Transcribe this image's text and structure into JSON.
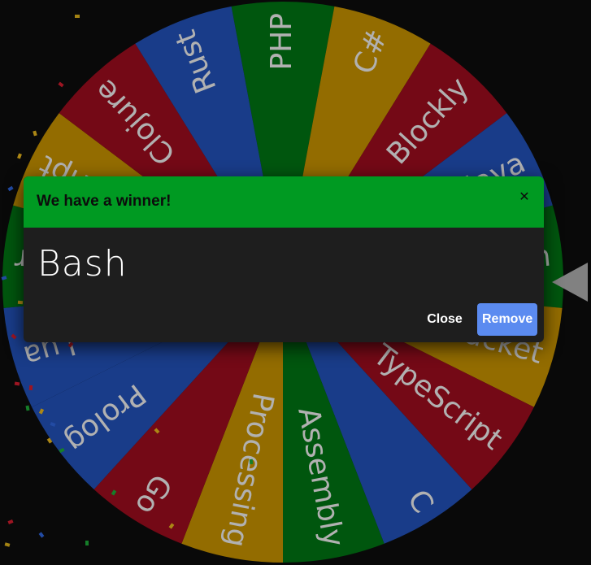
{
  "wheel": {
    "segments": [
      {
        "label": "PHP",
        "color": "#006a12"
      },
      {
        "label": "C#",
        "color": "#b48400"
      },
      {
        "label": "Blockly",
        "color": "#8e0b1b"
      },
      {
        "label": "Java",
        "color": "#1f4aa8"
      },
      {
        "label": "Bash",
        "color": "#006a12"
      },
      {
        "label": "Racket",
        "color": "#b48400"
      },
      {
        "label": "TypeScript",
        "color": "#8e0b1b"
      },
      {
        "label": "C",
        "color": "#1f4aa8"
      },
      {
        "label": "Assembly",
        "color": "#006a12"
      },
      {
        "label": "Processing",
        "color": "#b48400"
      },
      {
        "label": "Go",
        "color": "#8e0b1b"
      },
      {
        "label": "Prolog",
        "color": "#1f4aa8"
      },
      {
        "label": "Lua",
        "color": "#1f4aa8"
      },
      {
        "label": "Elixir",
        "color": "#006a12"
      },
      {
        "label": "JavaScript",
        "color": "#b48400"
      },
      {
        "label": "Clojure",
        "color": "#8e0b1b"
      },
      {
        "label": "Rust",
        "color": "#1f4aa8"
      }
    ],
    "text_color": "#d8d8d8",
    "pointer_color": "#9e9e9e"
  },
  "dialog": {
    "title": "We have a winner!",
    "close_icon": "close-icon",
    "winner": "Bash",
    "close_label": "Close",
    "remove_label": "Remove",
    "header_color": "#009a22",
    "remove_color": "#5b8bf0"
  }
}
